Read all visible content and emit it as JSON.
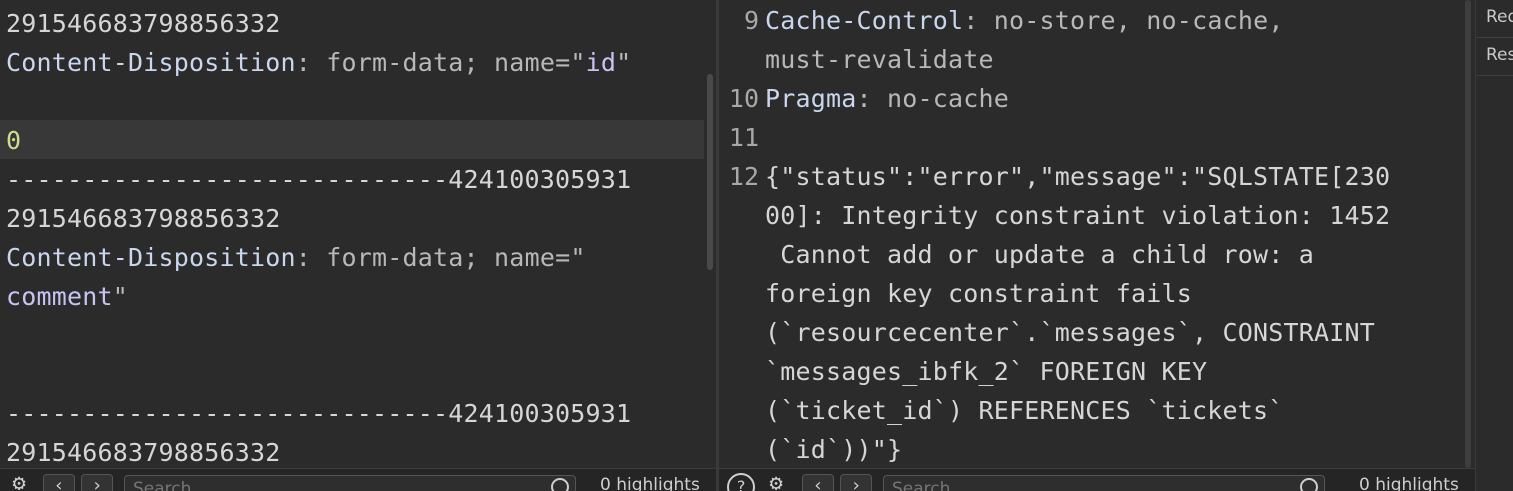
{
  "request": {
    "lines": [
      {
        "type": "plain",
        "text": "291546683798856332"
      },
      {
        "type": "header",
        "key": "Content-Disposition",
        "sep": ": ",
        "val": "form-data; name=\"",
        "str": "id",
        "end": "\""
      },
      {
        "type": "blank",
        "text": ""
      },
      {
        "type": "value",
        "text": "0"
      },
      {
        "type": "plain",
        "text": "-----------------------------424100305931"
      },
      {
        "type": "plain",
        "text": "291546683798856332"
      },
      {
        "type": "header",
        "key": "Content-Disposition",
        "sep": ": ",
        "val": "form-data; name=\"",
        "str": "",
        "end": ""
      },
      {
        "type": "wrapstr",
        "str": "comment",
        "end": "\""
      },
      {
        "type": "blank",
        "text": ""
      },
      {
        "type": "blank",
        "text": ""
      },
      {
        "type": "plain",
        "text": "-----------------------------424100305931"
      },
      {
        "type": "plain",
        "text": "291546683798856332"
      }
    ],
    "search_placeholder": "Search",
    "highlights": "0 highlights"
  },
  "response": {
    "rows": [
      {
        "num": "9",
        "key": "Cache-Control",
        "sep": ": ",
        "val": "no-store, no-cache,"
      },
      {
        "num": "",
        "key": "",
        "sep": "",
        "val": "must-revalidate"
      },
      {
        "num": "10",
        "key": "Pragma",
        "sep": ": ",
        "val": "no-cache"
      },
      {
        "num": "11",
        "key": "",
        "sep": "",
        "val": ""
      },
      {
        "num": "12",
        "key": "",
        "sep": "",
        "val": "{\"status\":\"error\",\"message\":\"SQLSTATE[230"
      },
      {
        "num": "",
        "key": "",
        "sep": "",
        "val": "00]: Integrity constraint violation: 1452"
      },
      {
        "num": "",
        "key": "",
        "sep": "",
        "val": " Cannot add or update a child row: a"
      },
      {
        "num": "",
        "key": "",
        "sep": "",
        "val": "foreign key constraint fails"
      },
      {
        "num": "",
        "key": "",
        "sep": "",
        "val": "(`resourcecenter`.`messages`, CONSTRAINT"
      },
      {
        "num": "",
        "key": "",
        "sep": "",
        "val": "`messages_ibfk_2` FOREIGN KEY"
      },
      {
        "num": "",
        "key": "",
        "sep": "",
        "val": "(`ticket_id`) REFERENCES `tickets`"
      },
      {
        "num": "",
        "key": "",
        "sep": "",
        "val": "(`id`))\"}"
      }
    ],
    "search_placeholder": "Search",
    "highlights": "0 highlights"
  },
  "side_tabs": [
    "Request attributes",
    "Response headers"
  ],
  "icons": {
    "settings": "gear-icon",
    "prev": "chevron-left-icon",
    "next": "chevron-right-icon",
    "help": "help-icon",
    "search": "search-icon"
  }
}
